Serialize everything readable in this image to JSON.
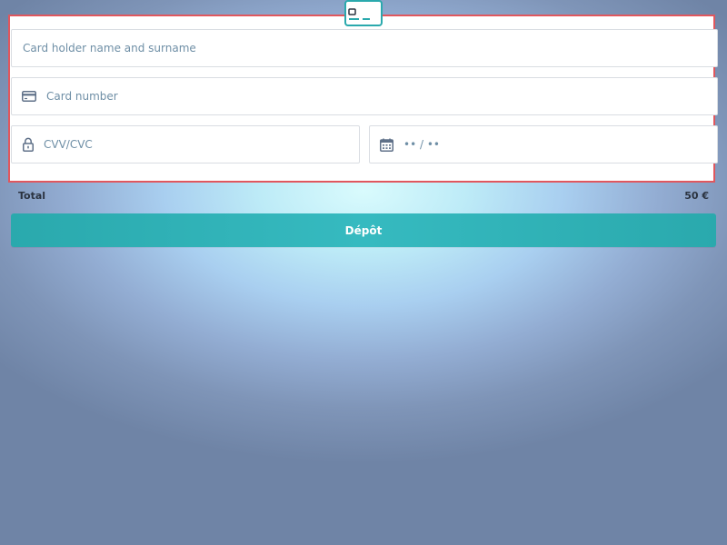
{
  "form": {
    "cardholder_placeholder": "Card holder name and surname",
    "card_number_placeholder": "Card number",
    "cvv_placeholder": "CVV/CVC",
    "expiry_placeholder": "•• / ••"
  },
  "summary": {
    "total_label": "Total",
    "total_value": "50 €"
  },
  "actions": {
    "deposit_label": "Dépôt"
  },
  "icons": {
    "top": "credit-card-icon",
    "card_number": "credit-card-icon",
    "cvv": "lock-icon",
    "expiry": "calendar-icon"
  },
  "colors": {
    "accent": "#2aa9ad",
    "highlight_border": "#e0575e",
    "placeholder_text": "#6f8fa6",
    "icon_stroke": "#5f7088"
  }
}
